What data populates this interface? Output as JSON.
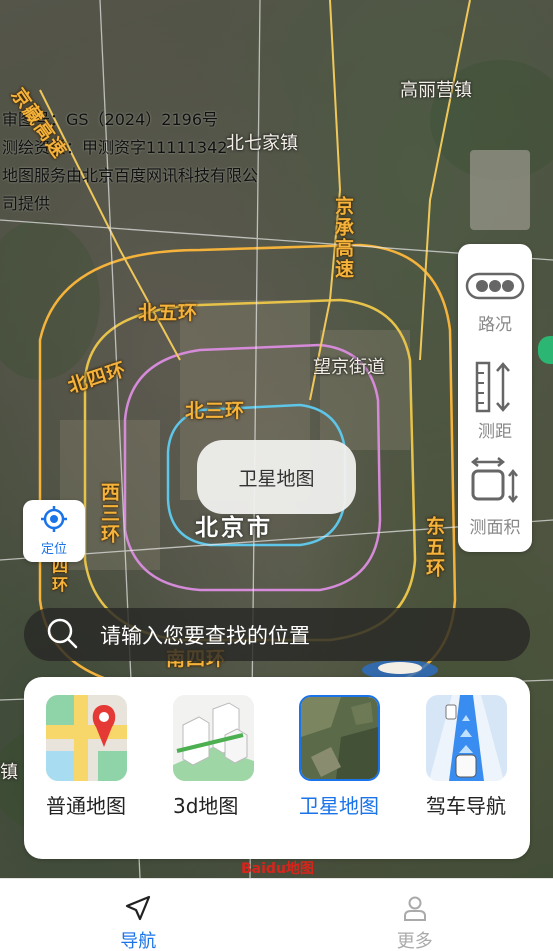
{
  "map": {
    "attribution_lines": [
      "审图号：GS（2024）2196号",
      "测绘资质：甲测资字11111342",
      "地图服务由北京百度网讯科技有限公",
      "司提供"
    ],
    "place_labels": {
      "gaoliying": "高丽营镇",
      "beiqijia": "北七家镇",
      "wangjing": "望京街道",
      "city": "北京市"
    },
    "road_labels": {
      "jingzang": "京藏高速",
      "jingcheng": "京承高速",
      "north5": "北五环",
      "north4": "北四环",
      "north3": "北三环",
      "west3": "西三环",
      "west4": "西四环",
      "east5": "东五环",
      "south4": "南四环",
      "edge_left": "镇"
    }
  },
  "tools": [
    {
      "label": "路况",
      "icon": "traffic-icon"
    },
    {
      "label": "测距",
      "icon": "ruler-icon"
    },
    {
      "label": "测面积",
      "icon": "area-icon"
    }
  ],
  "locate": {
    "label": "定位",
    "icon": "crosshair-icon"
  },
  "toast": {
    "text": "卫星地图"
  },
  "search": {
    "placeholder": "请输入您要查找的位置",
    "icon": "search-icon"
  },
  "map_types": [
    {
      "name": "普通地图",
      "selected": false
    },
    {
      "name": "3d地图",
      "selected": false
    },
    {
      "name": "卫星地图",
      "selected": true
    },
    {
      "name": "驾车导航",
      "selected": false
    }
  ],
  "logo": {
    "text": "Baidu地图"
  },
  "nav": {
    "tabs": [
      {
        "label": "导航",
        "icon": "navigation-arrow-icon",
        "active": true
      },
      {
        "label": "更多",
        "icon": "person-icon",
        "active": false
      }
    ],
    "active_color": "#1a73e8",
    "inactive_color": "#aaaaaa"
  },
  "colors": {
    "accent": "#1a73e8",
    "ring_road": "#f5b33b"
  }
}
